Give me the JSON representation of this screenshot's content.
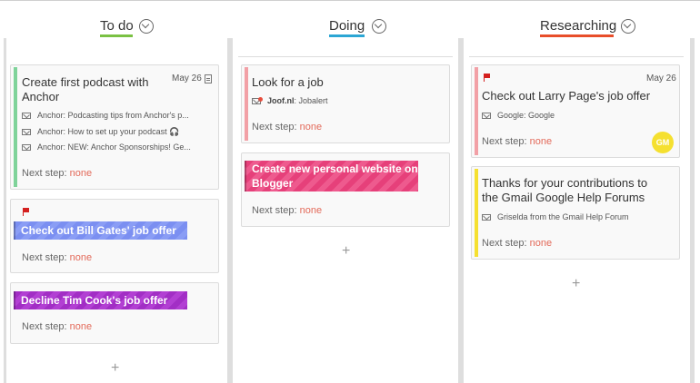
{
  "colors": {
    "todo_underline": "#7ac143",
    "doing_underline": "#2ba6d4",
    "researching_underline": "#e84e2a",
    "green_stripe": "#7fd39a",
    "pink_stripe": "#f2a0a6",
    "yellow_stripe": "#f5e030",
    "banner_blue": "#7d92f2",
    "banner_purple": "#a52fc7",
    "banner_pink": "#e8457e",
    "avatar": "#f5e030"
  },
  "columns": {
    "todo": {
      "title": "To do",
      "add_label": "+",
      "cards": [
        {
          "title": "Create first podcast with Anchor",
          "date": "May 26",
          "icon": "doc-icon",
          "mails": [
            "Anchor: Podcasting tips from Anchor's p...",
            "Anchor: How to set up your podcast 🎧",
            "Anchor: NEW: Anchor Sponsorships! Ge..."
          ],
          "next_label": "Next step:",
          "next_value": "none"
        },
        {
          "title": "Check out Bill Gates' job offer",
          "next_label": "Next step:",
          "next_value": "none"
        },
        {
          "title": "Decline Tim Cook's job offer",
          "next_label": "Next step:",
          "next_value": "none"
        }
      ]
    },
    "doing": {
      "title": "Doing",
      "add_label": "+",
      "cards": [
        {
          "title": "Look for a job",
          "mail_sender": "Joof.nl",
          "mail_subject": ": Jobalert",
          "next_label": "Next step:",
          "next_value": "none"
        },
        {
          "title_line1": "Create new personal website on",
          "title_line2": "Blogger",
          "next_label": "Next step:",
          "next_value": "none"
        }
      ]
    },
    "researching": {
      "title": "Researching",
      "add_label": "+",
      "cards": [
        {
          "title": "Check out Larry Page's job offer",
          "date": "May 26",
          "mail": "Google: Google",
          "avatar": "GM",
          "next_label": "Next step:",
          "next_value": "none"
        },
        {
          "title": "Thanks for your contributions to the Gmail Google Help Forums",
          "mail": "Griselda from the Gmail Help Forum",
          "next_label": "Next step:",
          "next_value": "none"
        }
      ]
    }
  }
}
